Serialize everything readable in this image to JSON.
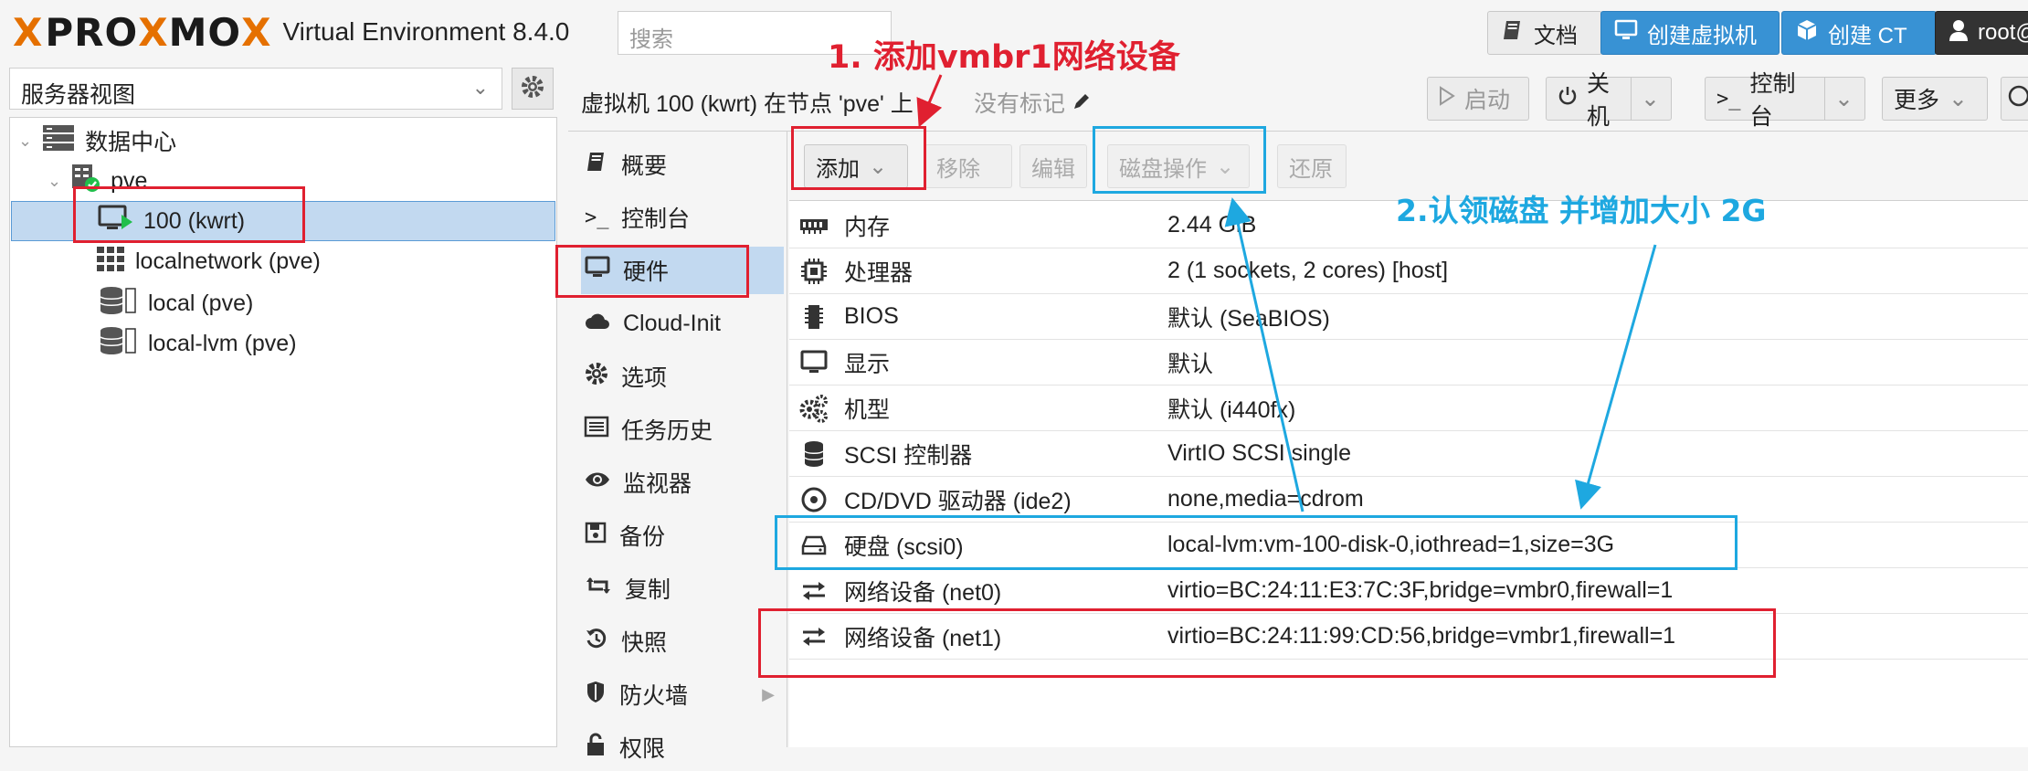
{
  "header": {
    "logo_x": "X",
    "logo_pro": "PRO",
    "logo_x2": "X",
    "logo_mo": "MO",
    "logo_x3": "X",
    "product": "Virtual Environment 8.4.0",
    "search_placeholder": "搜索",
    "docs_label": "文档",
    "create_vm_label": "创建虚拟机",
    "create_ct_label": "创建 CT",
    "user_label": "root@"
  },
  "tree": {
    "view_label": "服务器视图",
    "items": [
      {
        "label": "数据中心"
      },
      {
        "label": "pve"
      },
      {
        "label": "100 (kwrt)"
      },
      {
        "label": "localnetwork (pve)"
      },
      {
        "label": "local (pve)"
      },
      {
        "label": "local-lvm (pve)"
      }
    ]
  },
  "vm": {
    "title": "虚拟机 100 (kwrt) 在节点 'pve' 上",
    "tags": "没有标记",
    "start_label": "启动",
    "shutdown_label": "关机",
    "console_label": "控制台",
    "more_label": "更多"
  },
  "nav": {
    "items": [
      {
        "label": "概要"
      },
      {
        "label": "控制台"
      },
      {
        "label": "硬件"
      },
      {
        "label": "Cloud-Init"
      },
      {
        "label": "选项"
      },
      {
        "label": "任务历史"
      },
      {
        "label": "监视器"
      },
      {
        "label": "备份"
      },
      {
        "label": "复制"
      },
      {
        "label": "快照"
      },
      {
        "label": "防火墙"
      },
      {
        "label": "权限"
      }
    ]
  },
  "toolbar": {
    "add_label": "添加",
    "remove_label": "移除",
    "edit_label": "编辑",
    "disk_action_label": "磁盘操作",
    "revert_label": "还原"
  },
  "hardware": [
    {
      "key": "内存",
      "value": "2.44 GiB"
    },
    {
      "key": "处理器",
      "value": "2 (1 sockets, 2 cores) [host]"
    },
    {
      "key": "BIOS",
      "value": "默认 (SeaBIOS)"
    },
    {
      "key": "显示",
      "value": "默认"
    },
    {
      "key": "机型",
      "value": "默认 (i440fx)"
    },
    {
      "key": "SCSI 控制器",
      "value": "VirtIO SCSI single"
    },
    {
      "key": "CD/DVD 驱动器 (ide2)",
      "value": "none,media=cdrom"
    },
    {
      "key": "硬盘 (scsi0)",
      "value": "local-lvm:vm-100-disk-0,iothread=1,size=3G"
    },
    {
      "key": "网络设备 (net0)",
      "value": "virtio=BC:24:11:E3:7C:3F,bridge=vmbr0,firewall=1"
    },
    {
      "key": "网络设备 (net1)",
      "value": "virtio=BC:24:11:99:CD:56,bridge=vmbr1,firewall=1"
    }
  ],
  "annotations": {
    "note1": "1. 添加vmbr1网络设备",
    "note2": "2.认领磁盘 并增加大小 2G",
    "red": "#e02030",
    "blue": "#1ea8e0"
  }
}
